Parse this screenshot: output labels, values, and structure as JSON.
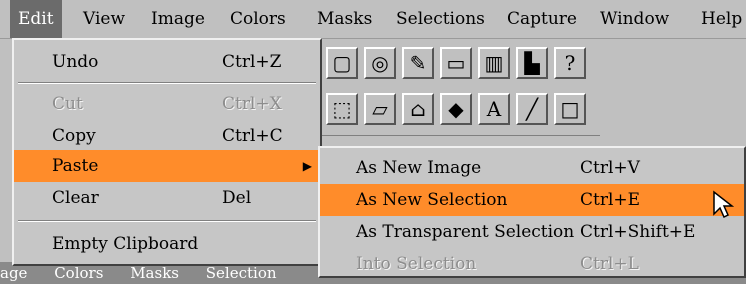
{
  "menubar": {
    "items": [
      {
        "label": "Edit",
        "accel": "E"
      },
      {
        "label": "View",
        "accel": "V"
      },
      {
        "label": "Image",
        "accel": "I"
      },
      {
        "label": "Colors",
        "accel": "C"
      },
      {
        "label": "Masks",
        "accel": "M"
      },
      {
        "label": "Selections",
        "accel": "S"
      },
      {
        "label": "Capture",
        "accel": "a"
      },
      {
        "label": "Window",
        "accel": "W"
      },
      {
        "label": "Help",
        "accel": "H"
      }
    ]
  },
  "edit_menu": {
    "items": [
      {
        "label": "Undo",
        "accel": "U",
        "shortcut": "Ctrl+Z",
        "disabled": false
      },
      {
        "label": "Cut",
        "accel": "t",
        "shortcut": "Ctrl+X",
        "disabled": true
      },
      {
        "label": "Copy",
        "accel": "C",
        "shortcut": "Ctrl+C",
        "disabled": false
      },
      {
        "label": "Paste",
        "accel": "P",
        "shortcut": "",
        "disabled": false,
        "submenu_arrow": "▶"
      },
      {
        "label": "Clear",
        "accel": "l",
        "shortcut": "Del",
        "disabled": false
      },
      {
        "label": "Empty Clipboard",
        "accel": "E",
        "shortcut": "",
        "disabled": false
      }
    ]
  },
  "paste_submenu": {
    "items": [
      {
        "label": "As New Image",
        "accel": "N",
        "shortcut": "Ctrl+V",
        "disabled": false
      },
      {
        "label": "As New Selection",
        "accel": "S",
        "shortcut": "Ctrl+E",
        "disabled": false
      },
      {
        "label": "As Transparent Selection",
        "accel": "T",
        "shortcut": "Ctrl+Shift+E",
        "disabled": false
      },
      {
        "label": "Into Selection",
        "accel": "",
        "shortcut": "Ctrl+L",
        "disabled": true
      }
    ]
  },
  "toolbar_row1": {
    "icons": [
      "grid-icon",
      "gauge-icon",
      "paintbrush-icon",
      "keyboard-icon",
      "color-bars-icon",
      "histogram-icon",
      "help-cursor-icon"
    ],
    "glyphs": [
      "▢",
      "◎",
      "✎",
      "▭",
      "▥",
      "▙",
      "?"
    ]
  },
  "toolbar_row2": {
    "icons": [
      "select-icon",
      "eraser-icon",
      "fill-icon",
      "shape-icon",
      "text-tool-icon",
      "line-tool-icon",
      "rectangle-tool-icon"
    ],
    "glyphs": [
      "⬚",
      "▱",
      "⌂",
      "◆",
      "A",
      "╱",
      "□"
    ]
  },
  "bottom_strip": {
    "items": [
      "age",
      "Colors",
      "Masks",
      "Selection"
    ]
  },
  "colors": {
    "highlight": "#ff8c2a",
    "menu_bg": "#c6c6c6",
    "active_title": "#6b6b6b"
  }
}
